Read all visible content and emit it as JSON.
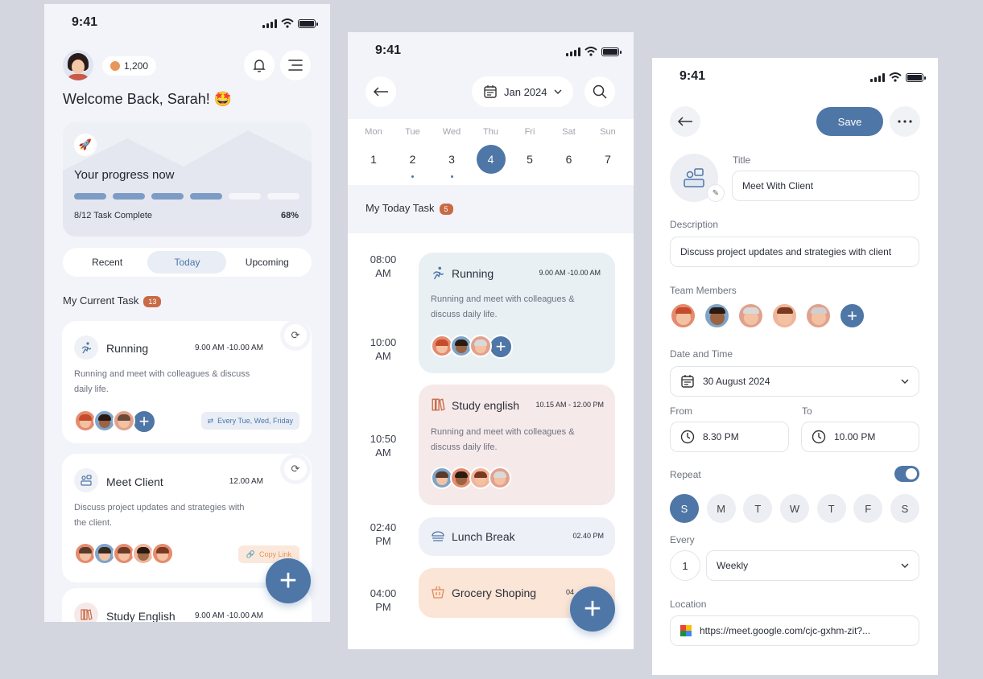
{
  "colors": {
    "accent": "#4e76a6",
    "badge": "#c96a45",
    "running_card": "#e9f0f4",
    "study_card": "#f6e9e9",
    "lunch_card": "#eef0f7",
    "grocery_card": "#fbe5d6"
  },
  "s1": {
    "time": "9:41",
    "coins": "1,200",
    "welcome": "Welcome Back, Sarah! 🤩",
    "progress": {
      "title": "Your progress now",
      "summary": "8/12 Task Complete",
      "percent": "68%",
      "segments_done": 4,
      "segments_total": 6
    },
    "tabs": [
      "Recent",
      "Today",
      "Upcoming"
    ],
    "active_tab": 1,
    "section_title": "My Current Task",
    "section_count": "13",
    "tasks": [
      {
        "name": "Running",
        "time": "9.00 AM -10.00 AM",
        "desc_1": "Running and meet with colleagues & discuss",
        "desc_2": "daily life.",
        "tag": "Every Tue, Wed, Friday"
      },
      {
        "name": "Meet Client",
        "time": "12.00 AM",
        "desc_1": "Discuss project updates and strategies with",
        "desc_2": "the client.",
        "tag": "Copy Link"
      },
      {
        "name": "Study English",
        "time": "9.00 AM -10.00 AM"
      }
    ],
    "fab": "+"
  },
  "s2": {
    "time": "9:41",
    "month": "Jan 2024",
    "days": [
      {
        "dow": "Mon",
        "num": "1"
      },
      {
        "dow": "Tue",
        "num": "2"
      },
      {
        "dow": "Wed",
        "num": "3"
      },
      {
        "dow": "Thu",
        "num": "4"
      },
      {
        "dow": "Fri",
        "num": "5"
      },
      {
        "dow": "Sat",
        "num": "6"
      },
      {
        "dow": "Sun",
        "num": "7"
      }
    ],
    "selected_day": 3,
    "section_title": "My Today Task",
    "section_count": "5",
    "slots": [
      {
        "t1": "08:00",
        "t2": "AM"
      },
      {
        "t1": "10:00",
        "t2": "AM"
      },
      {
        "t1": "10:50",
        "t2": "AM"
      },
      {
        "t1": "02:40",
        "t2": "PM"
      },
      {
        "t1": "04:00",
        "t2": "PM"
      }
    ],
    "events": [
      {
        "name": "Running",
        "time": "9.00 AM -10.00 AM",
        "desc_1": "Running and meet with colleagues &",
        "desc_2": "discuss daily life."
      },
      {
        "name": "Study english",
        "time": "10.15 AM - 12.00 PM",
        "desc_1": "Running and meet with colleagues &",
        "desc_2": "discuss daily life."
      },
      {
        "name": "Lunch Break",
        "time": "02.40 PM"
      },
      {
        "name": "Grocery Shoping",
        "time": "04"
      }
    ],
    "fab": "+"
  },
  "s3": {
    "time": "9:41",
    "save": "Save",
    "title_label": "Title",
    "title_value": "Meet With Client",
    "desc_label": "Description",
    "desc_value": "Discuss project updates and strategies with client",
    "team_label": "Team Members",
    "date_label": "Date and Time",
    "date_value": "30 August 2024",
    "from_label": "From",
    "from_value": "8.30 PM",
    "to_label": "To",
    "to_value": "10.00 PM",
    "repeat_label": "Repeat",
    "repeat_on": true,
    "weekdays": [
      "S",
      "M",
      "T",
      "W",
      "T",
      "F",
      "S"
    ],
    "selected_weekday": 0,
    "every_label": "Every",
    "every_count": "1",
    "every_unit": "Weekly",
    "location_label": "Location",
    "location_value": "https://meet.google.com/cjc-gxhm-zit?..."
  }
}
